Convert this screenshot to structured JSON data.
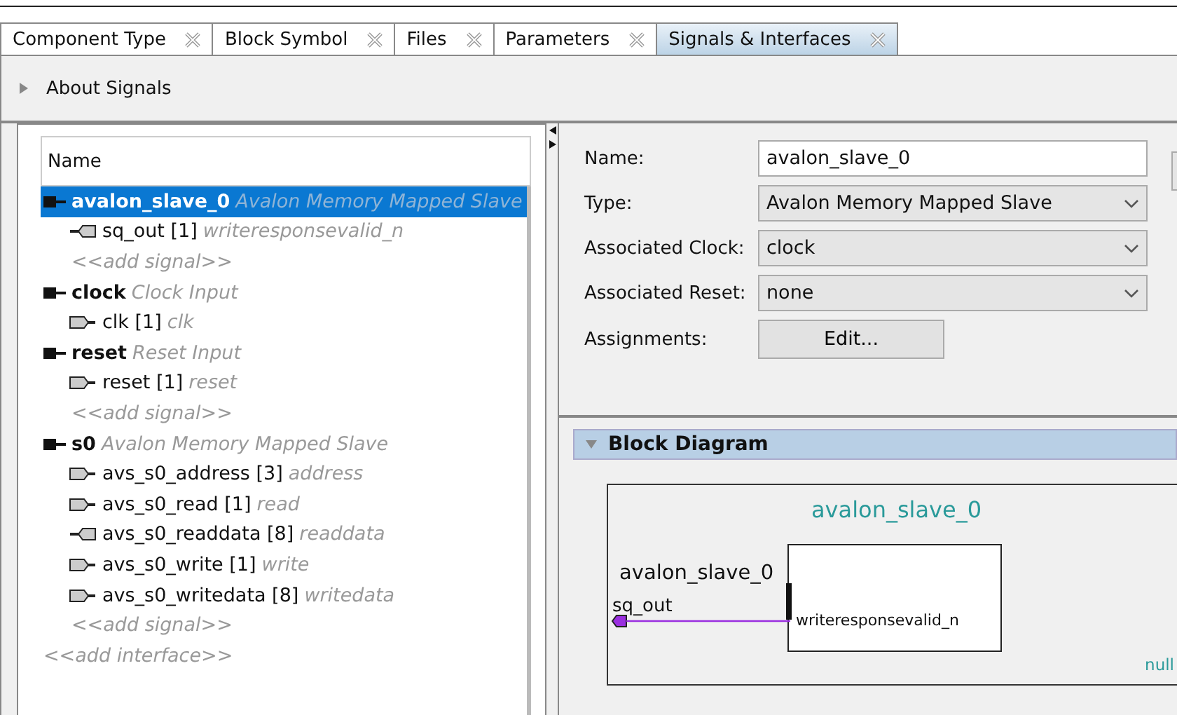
{
  "tabs": [
    {
      "label": "Component Type",
      "selected": false
    },
    {
      "label": "Block Symbol",
      "selected": false
    },
    {
      "label": "Files",
      "selected": false
    },
    {
      "label": "Parameters",
      "selected": false
    },
    {
      "label": "Signals & Interfaces",
      "selected": true
    }
  ],
  "about": {
    "label": "About Signals",
    "expanded": false
  },
  "tree": {
    "header": "Name",
    "items": [
      {
        "kind": "interface",
        "name": "avalon_slave_0",
        "type": "Avalon Memory Mapped Slave",
        "selected": true,
        "children": [
          {
            "kind": "output",
            "name": "sq_out [1]",
            "role": "writeresponsevalid_n",
            "selected": false
          },
          {
            "kind": "add",
            "label": "<<add signal>>",
            "selected": false
          }
        ]
      },
      {
        "kind": "interface",
        "name": "clock",
        "type": "Clock Input",
        "selected": false,
        "children": [
          {
            "kind": "input",
            "name": "clk [1]",
            "role": "clk",
            "selected": false
          }
        ]
      },
      {
        "kind": "interface",
        "name": "reset",
        "type": "Reset Input",
        "selected": false,
        "children": [
          {
            "kind": "input",
            "name": "reset [1]",
            "role": "reset",
            "selected": false
          },
          {
            "kind": "add",
            "label": "<<add signal>>",
            "selected": false
          }
        ]
      },
      {
        "kind": "interface",
        "name": "s0",
        "type": "Avalon Memory Mapped Slave",
        "selected": false,
        "children": [
          {
            "kind": "input",
            "name": "avs_s0_address [3]",
            "role": "address",
            "selected": false
          },
          {
            "kind": "input",
            "name": "avs_s0_read [1]",
            "role": "read",
            "selected": false
          },
          {
            "kind": "output",
            "name": "avs_s0_readdata [8]",
            "role": "readdata",
            "selected": false
          },
          {
            "kind": "input",
            "name": "avs_s0_write [1]",
            "role": "write",
            "selected": false
          },
          {
            "kind": "input",
            "name": "avs_s0_writedata [8]",
            "role": "writedata",
            "selected": false
          },
          {
            "kind": "add",
            "label": "<<add signal>>",
            "selected": false
          }
        ]
      },
      {
        "kind": "add",
        "label": "<<add interface>>",
        "selected": false
      }
    ]
  },
  "form": [
    {
      "kind": "text",
      "label": "Name:",
      "value": "avalon_slave_0"
    },
    {
      "kind": "select",
      "label": "Type:",
      "value": "Avalon Memory Mapped Slave"
    },
    {
      "kind": "select",
      "label": "Associated Clock:",
      "value": "clock"
    },
    {
      "kind": "select",
      "label": "Associated Reset:",
      "value": "none"
    },
    {
      "kind": "button",
      "label": "Assignments:",
      "value": "Edit..."
    }
  ],
  "block_diagram": {
    "title": "Block Diagram",
    "expanded": true,
    "instance_title": "avalon_slave_0",
    "interface_label": "avalon_slave_0",
    "port_name": "sq_out",
    "port_role": "writeresponsevalid_n",
    "corner_label": "null"
  }
}
